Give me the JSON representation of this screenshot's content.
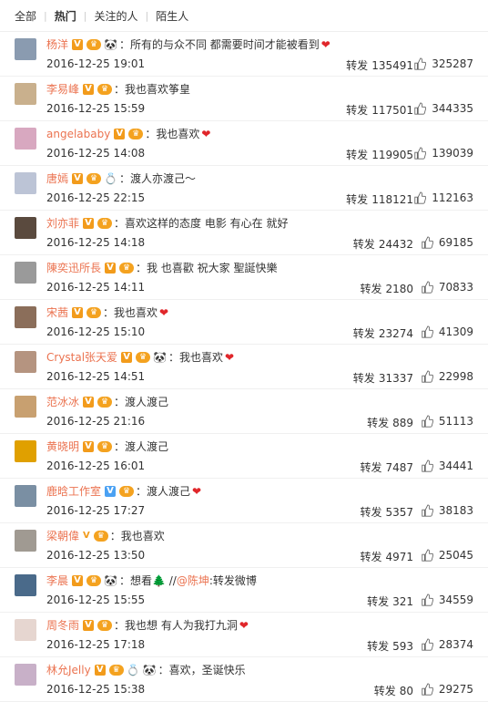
{
  "tabs": [
    "全部",
    "热门",
    "关注的人",
    "陌生人"
  ],
  "rows": [
    {
      "name": "杨洋",
      "badges": [
        "v",
        "crown"
      ],
      "emojis": [
        "panda-icon"
      ],
      "text": "：所有的与众不同 都需要时间才能被看到",
      "heart": "❤",
      "time": "2016-12-25 19:01",
      "repost_label": "转发",
      "repost": "135491",
      "likes": "325287",
      "avatar_color": "#8a9bb0"
    },
    {
      "name": "李易峰",
      "badges": [
        "v",
        "crown"
      ],
      "emojis": [],
      "text": "：我也喜欢筝皇",
      "heart": "",
      "time": "2016-12-25 15:59",
      "repost_label": "转发",
      "repost": "117501",
      "likes": "344335",
      "avatar_color": "#c9b08d"
    },
    {
      "name": "angelababy",
      "badges": [
        "v",
        "crown"
      ],
      "emojis": [],
      "text": "：我也喜欢",
      "heart": "❤",
      "time": "2016-12-25 14:08",
      "repost_label": "转发",
      "repost": "119905",
      "likes": "139039",
      "avatar_color": "#d8a8c0"
    },
    {
      "name": "唐嫣",
      "badges": [
        "v",
        "crown"
      ],
      "emojis": [
        "ring-icon"
      ],
      "text": "：渡人亦渡己～",
      "heart": "",
      "time": "2016-12-25 22:15",
      "repost_label": "转发",
      "repost": "118121",
      "likes": "112163",
      "avatar_color": "#bcc4d6"
    },
    {
      "name": "刘亦菲",
      "badges": [
        "v",
        "crown"
      ],
      "emojis": [],
      "text": "：喜欢这样的态度 电影 有心在 就好",
      "heart": "",
      "time": "2016-12-25 14:18",
      "repost_label": "转发",
      "repost": "24432",
      "likes": "69185",
      "avatar_color": "#5a4a3e"
    },
    {
      "name": "陳奕迅所長",
      "badges": [
        "v",
        "crown"
      ],
      "emojis": [],
      "text": "：我  也喜歡 祝大家 聖誕快樂",
      "heart": "",
      "time": "2016-12-25 14:11",
      "repost_label": "转发",
      "repost": "2180",
      "likes": "70833",
      "avatar_color": "#9a9a9a"
    },
    {
      "name": "宋茜",
      "badges": [
        "v",
        "crown"
      ],
      "emojis": [],
      "text": "：我也喜欢",
      "heart": "❤",
      "time": "2016-12-25 15:10",
      "repost_label": "转发",
      "repost": "23274",
      "likes": "41309",
      "avatar_color": "#8b6e5a"
    },
    {
      "name": "Crystal张天爱",
      "badges": [
        "v",
        "crown"
      ],
      "emojis": [
        "panda-icon"
      ],
      "text": "：我也喜欢",
      "heart": "❤",
      "time": "2016-12-25 14:51",
      "repost_label": "转发",
      "repost": "31337",
      "likes": "22998",
      "avatar_color": "#b59480"
    },
    {
      "name": "范冰冰",
      "badges": [
        "v",
        "crown"
      ],
      "emojis": [],
      "text": "：渡人渡己",
      "heart": "",
      "time": "2016-12-25 21:16",
      "repost_label": "转发",
      "repost": "889",
      "likes": "51113",
      "avatar_color": "#c8a070"
    },
    {
      "name": "黄晓明",
      "badges": [
        "v",
        "crown"
      ],
      "emojis": [],
      "text": "：渡人渡己",
      "heart": "",
      "time": "2016-12-25 16:01",
      "repost_label": "转发",
      "repost": "7487",
      "likes": "34441",
      "avatar_color": "#e0a000"
    },
    {
      "name": "鹿晗工作室",
      "badges": [
        "vb",
        "crown"
      ],
      "emojis": [],
      "text": "：渡人渡己",
      "heart": "❤",
      "time": "2016-12-25 17:27",
      "repost_label": "转发",
      "repost": "5357",
      "likes": "38183",
      "avatar_color": "#7a8fa3"
    },
    {
      "name": "梁朝偉",
      "badges": [
        "vgold",
        "crown"
      ],
      "emojis": [],
      "text": "：我也喜欢",
      "heart": "",
      "time": "2016-12-25 13:50",
      "repost_label": "转发",
      "repost": "4971",
      "likes": "25045",
      "avatar_color": "#a09a92"
    },
    {
      "name": "李晨",
      "badges": [
        "v",
        "crown"
      ],
      "emojis": [
        "panda-icon"
      ],
      "text": "：想看🌲 //",
      "link": "@陈坤",
      "text2": ":转发微博",
      "heart": "",
      "time": "2016-12-25 15:55",
      "repost_label": "转发",
      "repost": "321",
      "likes": "34559",
      "avatar_color": "#4a6a8a"
    },
    {
      "name": "周冬雨",
      "badges": [
        "v",
        "crown"
      ],
      "emojis": [],
      "text": "：我也想 有人为我打九洞",
      "heart": "❤",
      "time": "2016-12-25 17:18",
      "repost_label": "转发",
      "repost": "593",
      "likes": "28374",
      "avatar_color": "#e6d6d0"
    },
    {
      "name": "林允Jelly",
      "badges": [
        "v",
        "crown"
      ],
      "emojis": [
        "ring-icon",
        "panda-icon"
      ],
      "text": "：喜欢，圣诞快乐",
      "heart": "",
      "time": "2016-12-25 15:38",
      "repost_label": "转发",
      "repost": "80",
      "likes": "29275",
      "avatar_color": "#c8b0c8"
    }
  ]
}
